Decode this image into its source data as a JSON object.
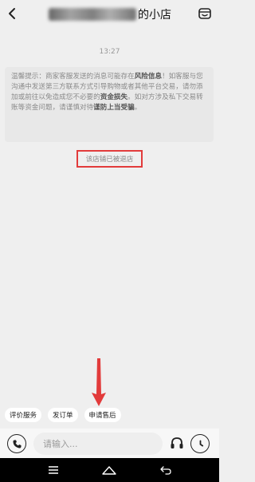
{
  "header": {
    "title_visible": "的小店",
    "back_icon": "chevron-left-icon",
    "shop_icon": "shop-icon"
  },
  "chat": {
    "time": "13:27",
    "notice": {
      "p1": "温馨提示：商家客服发送的消息可能存在",
      "b1": "风险信息",
      "p2": "！如客服与您沟通中发送第三方联系方式引导购物或者其他平台交易，请勿添加或前往以免造成您不必要的",
      "b2": "资金损失",
      "p3": "。如对方涉及私下交易转账等资金问题，请谨慎对待",
      "b3": "谨防上当受骗",
      "p4": "。"
    },
    "closed_label": "该店铺已被退店",
    "highlight_color": "#e23b3b"
  },
  "quick_actions": [
    {
      "label": "评价服务"
    },
    {
      "label": "发订单"
    },
    {
      "label": "申请售后"
    }
  ],
  "input_bar": {
    "placeholder": "请输入...",
    "phone_icon": "phone-icon",
    "service_icon": "headset-icon",
    "more_icon": "clock-icon"
  },
  "navbar": {
    "menu_icon": "menu-icon",
    "home_icon": "home-icon",
    "back_icon": "back-icon"
  }
}
